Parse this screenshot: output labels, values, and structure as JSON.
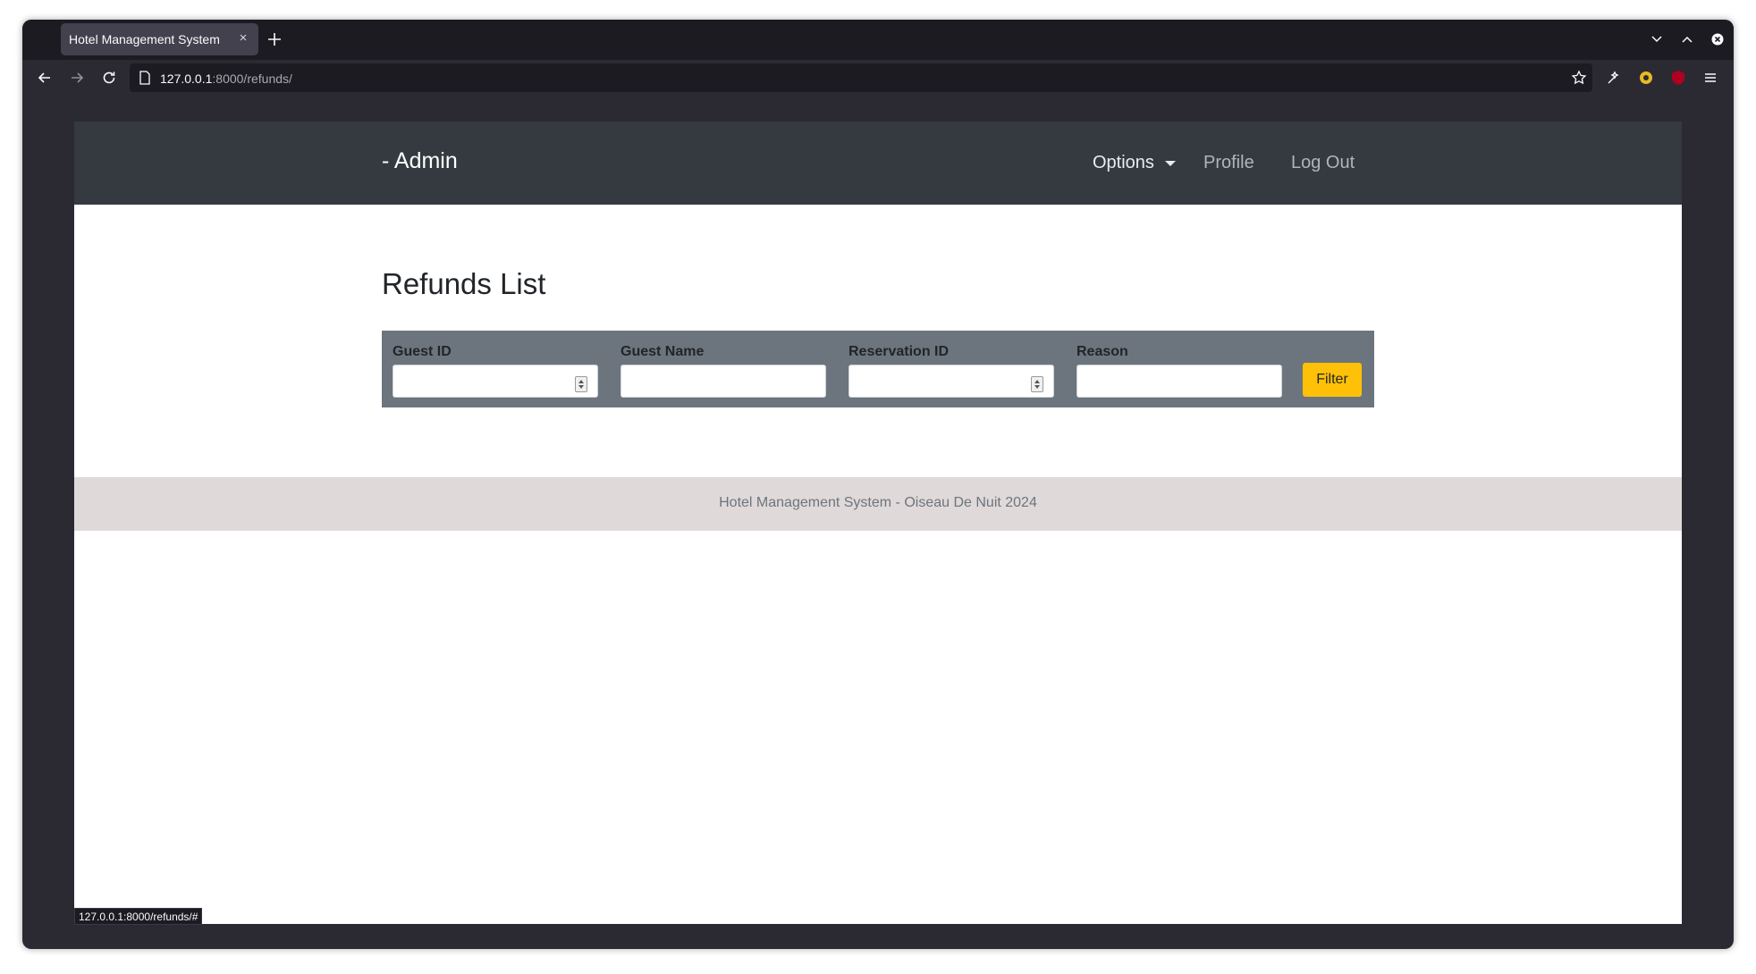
{
  "browser": {
    "tab_title": "Hotel Management System",
    "tab_close": "×",
    "url_host": "127.0.0.1",
    "url_rest": ":8000/refunds/",
    "status_url": "127.0.0.1:8000/refunds/#"
  },
  "navbar": {
    "brand": "- Admin",
    "options": "Options",
    "profile": "Profile",
    "logout": "Log Out"
  },
  "page": {
    "title": "Refunds List"
  },
  "filters": {
    "guest_id_label": "Guest ID",
    "guest_name_label": "Guest Name",
    "reservation_id_label": "Reservation ID",
    "reason_label": "Reason",
    "guest_id_value": "",
    "guest_name_value": "",
    "reservation_id_value": "",
    "reason_value": "",
    "button": "Filter"
  },
  "footer": {
    "text": "Hotel Management System - Oiseau De Nuit 2024"
  },
  "colors": {
    "navbar": "#343a40",
    "filter_bar": "#6c757d",
    "filter_button": "#ffc107",
    "footer": "#e0d9d9"
  }
}
